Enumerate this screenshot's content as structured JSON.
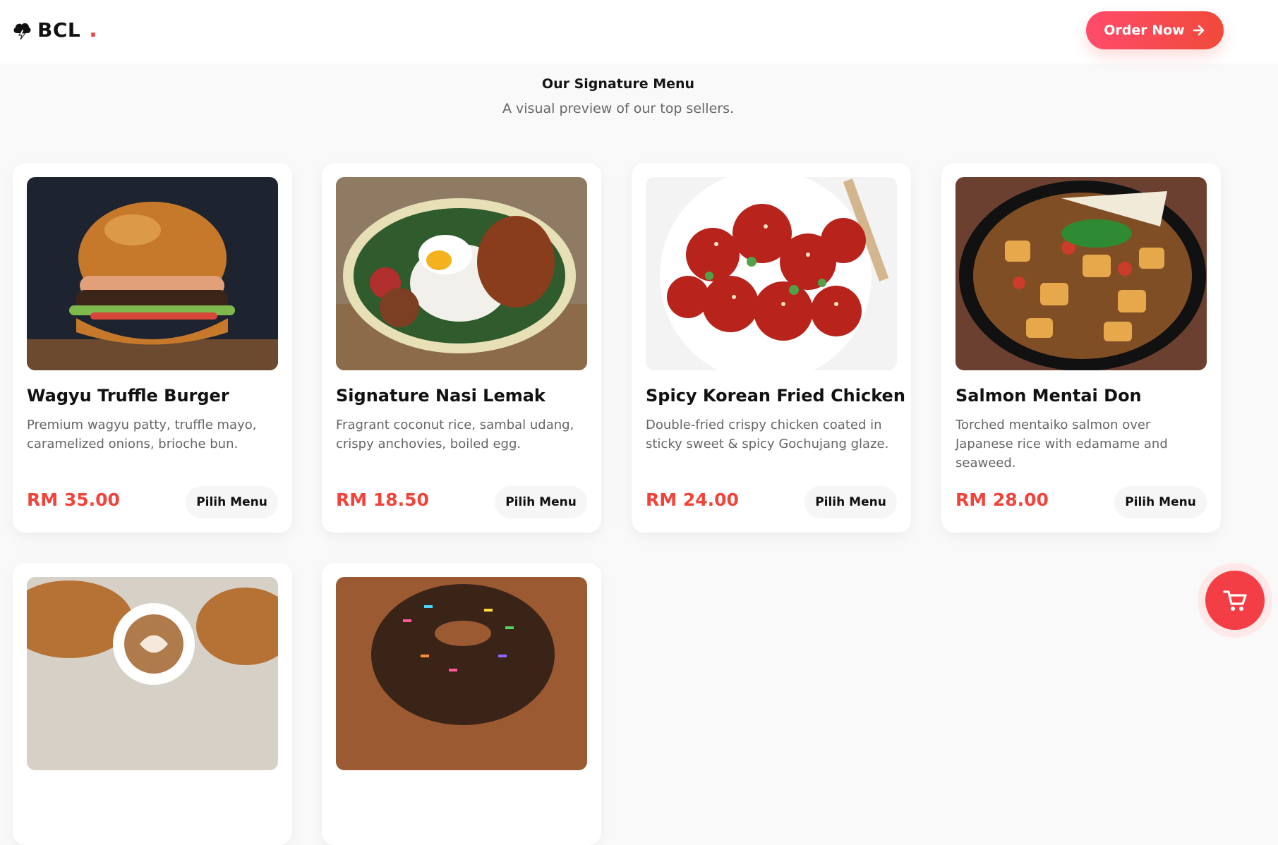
{
  "brand": {
    "name": "BCL",
    "dot": ".",
    "icon": "cloud-bolt-icon"
  },
  "header": {
    "order_label": "Order Now",
    "order_icon": "arrow-right-icon"
  },
  "menu_section": {
    "title": "Our Signature Menu",
    "subtitle": "A visual preview of our top sellers."
  },
  "items": [
    {
      "name": "Wagyu Truffle Burger",
      "desc": "Premium wagyu patty, truffle mayo, caramelized onions, brioche bun.",
      "price": "RM 35.00",
      "action": "Pilih Menu"
    },
    {
      "name": "Signature Nasi Lemak",
      "desc": "Fragrant coconut rice, sambal udang, crispy anchovies, boiled egg.",
      "price": "RM 18.50",
      "action": "Pilih Menu"
    },
    {
      "name": "Spicy Korean Fried Chicken",
      "desc": "Double-fried crispy chicken coated in sticky sweet & spicy Gochujang glaze.",
      "price": "RM 24.00",
      "action": "Pilih Menu"
    },
    {
      "name": "Salmon Mentai Don",
      "desc": "Torched mentaiko salmon over Japanese rice with edamame and seaweed.",
      "price": "RM 28.00",
      "action": "Pilih Menu"
    }
  ],
  "colors": {
    "accent": "#f2433a",
    "cart_bg": "#f43e45"
  },
  "cart": {
    "icon": "cart-icon"
  }
}
